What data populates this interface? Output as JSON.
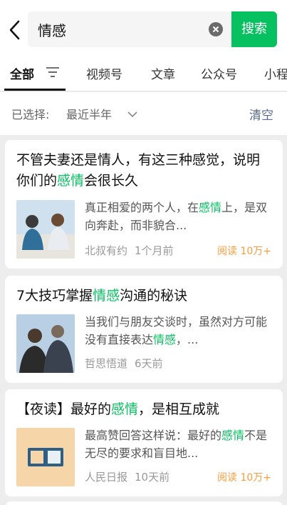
{
  "search": {
    "query": "情感",
    "button_label": "搜索"
  },
  "tabs": [
    {
      "label": "全部"
    },
    {
      "label": "视频号"
    },
    {
      "label": "文章"
    },
    {
      "label": "公众号"
    },
    {
      "label": "小程"
    }
  ],
  "filter": {
    "label": "已选择:",
    "value": "最近半年",
    "clear_label": "清空"
  },
  "results": [
    {
      "title_parts": [
        "不管夫妻还是情人，有这三种感觉，说明你们的",
        "感情",
        "会很长久"
      ],
      "snippet_parts": [
        "真正相爱的两个人，在",
        "感情",
        "上，是双向奔赴，而非貌合..."
      ],
      "source": "北叔有约",
      "time": "1个月前",
      "reads": "阅读 10万+"
    },
    {
      "title_parts": [
        "7大技巧掌握",
        "情感",
        "沟通的秘诀"
      ],
      "snippet_parts": [
        "当我们与朋友交谈时，虽然对方可能没有直接表达",
        "情感",
        "，..."
      ],
      "source": "哲思悟道",
      "time": "6天前",
      "reads": ""
    },
    {
      "title_parts": [
        "【夜读】最好的",
        "感情",
        "，是相互成就"
      ],
      "snippet_parts": [
        "最高赞回答这样说：最好的",
        "感情",
        "不是无尽的要求和盲目地..."
      ],
      "source": "人民日报",
      "time": "10天前",
      "reads": "阅读 10万+"
    }
  ],
  "colors": {
    "accent": "#07c160",
    "link": "#576b95",
    "reads": "#fa9d3b"
  }
}
